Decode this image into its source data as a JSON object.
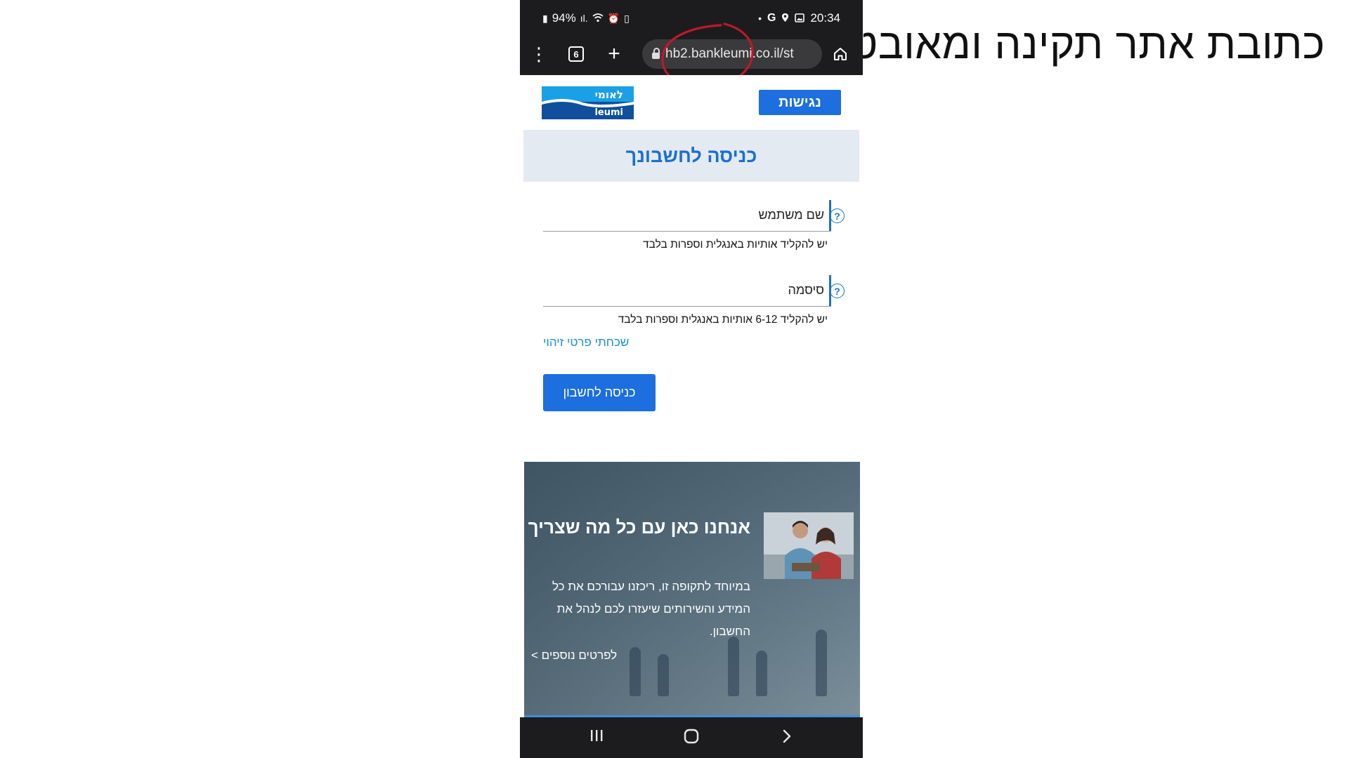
{
  "caption": "כתובת אתר תקינה  ומאובטחת",
  "status_bar": {
    "battery": "94%",
    "time": "20:34"
  },
  "browser": {
    "tab_count": "6",
    "url": "hb2.bankleumi.co.il/st"
  },
  "site": {
    "logo_hebrew": "לאומי",
    "logo_latin": "leumi",
    "accessibility_button": "נגישות"
  },
  "login": {
    "title": "כניסה לחשבונך",
    "username_label": "שם משתמש",
    "username_hint": "יש להקליד אותיות באנגלית וספרות בלבד",
    "password_label": "סיסמה",
    "password_hint": "יש להקליד 6-12 אותיות באנגלית וספרות בלבד",
    "forgot_link": "שכחתי פרטי זיהוי",
    "submit_button": "כניסה לחשבון"
  },
  "promo": {
    "title": "אנחנו כאן עם כל מה שצריך",
    "text": "במיוחד לתקופה זו, ריכזנו עבורכם את כל המידע והשירותים שיעזרו לכם לנהל את החשבון.",
    "link": "לפרטים נוספים >"
  },
  "icons": {
    "help": "?",
    "menu": "⋮",
    "plus": "+",
    "home": "home-icon"
  },
  "colors": {
    "brand_blue": "#1d6fe0",
    "annotation_red": "#c0182a",
    "header_bg": "#e4eaf1"
  }
}
